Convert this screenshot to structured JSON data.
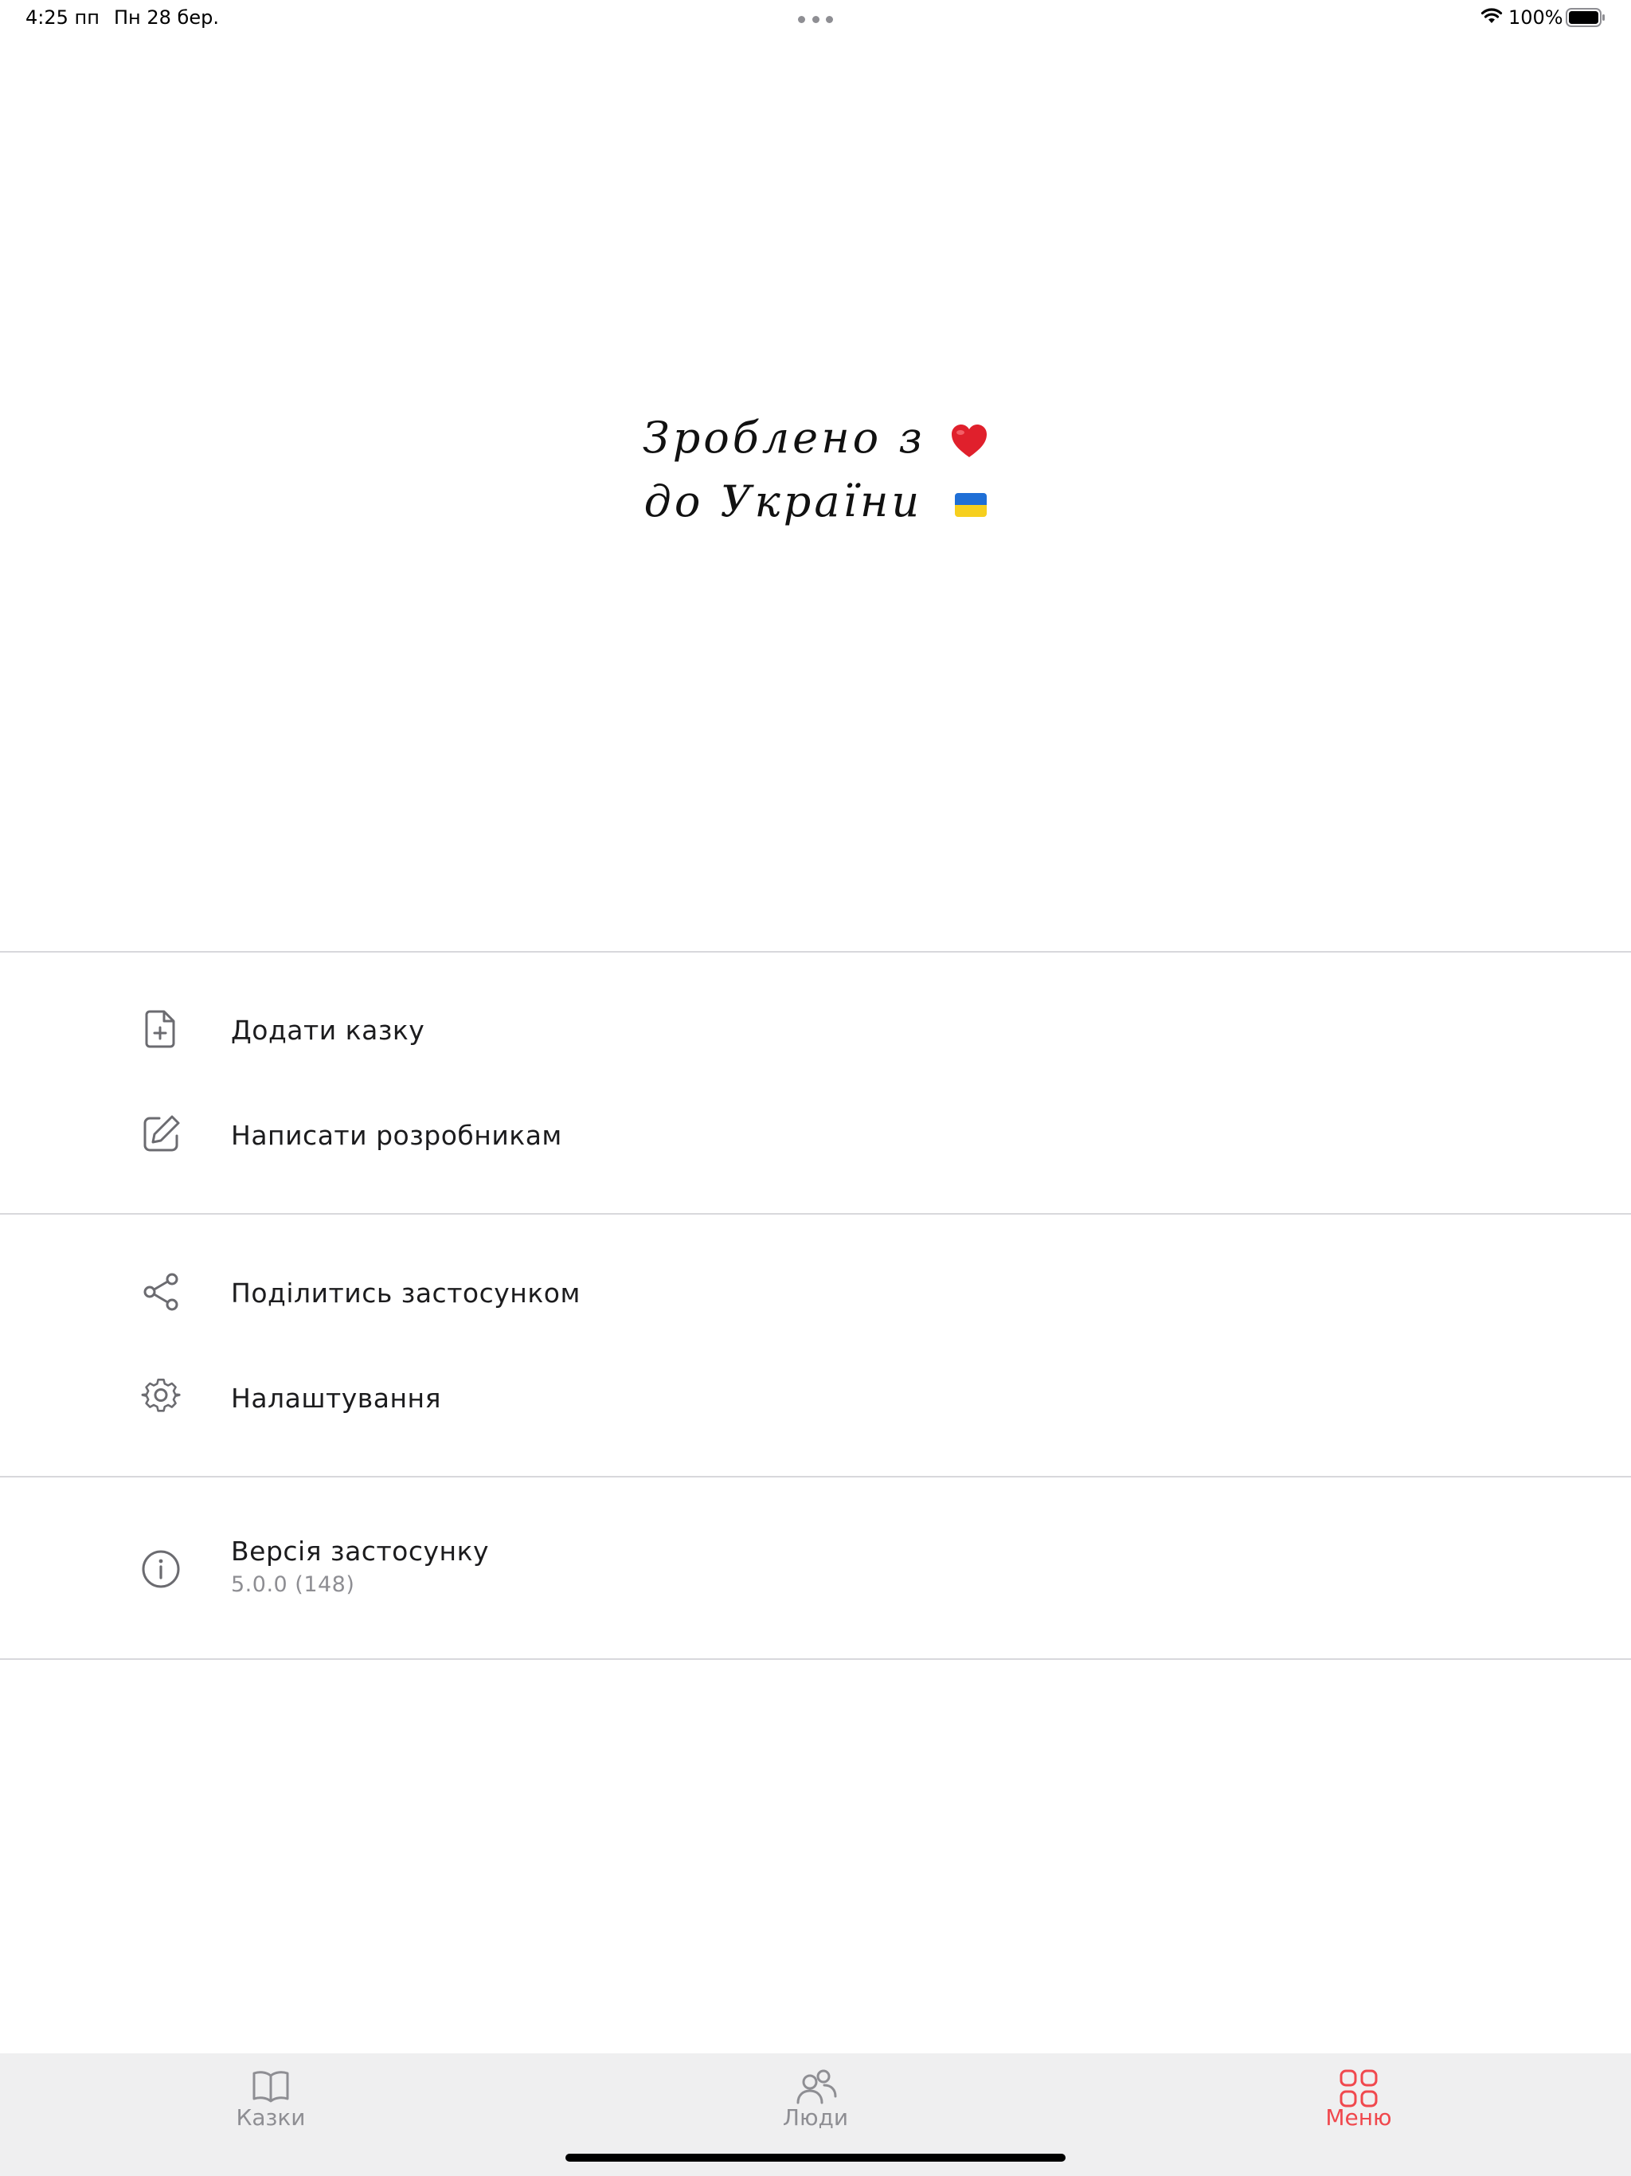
{
  "status_bar": {
    "time": "4:25 пп",
    "date": "Пн 28 бер.",
    "battery_percent": "100%",
    "icons": [
      "more-dots-icon",
      "wifi-icon",
      "battery-icon"
    ]
  },
  "hero": {
    "line1": "Зроблено з",
    "line2": "до України",
    "icons": [
      "heart-icon",
      "ukraine-flag-icon"
    ]
  },
  "menu": {
    "sections": [
      {
        "items": [
          {
            "label": "Додати казку",
            "icon": "add-document-icon"
          },
          {
            "label": "Написати розробникам",
            "icon": "edit-icon"
          }
        ]
      },
      {
        "items": [
          {
            "label": "Поділитись застосунком",
            "icon": "share-icon"
          },
          {
            "label": "Налаштування",
            "icon": "gear-icon"
          }
        ]
      },
      {
        "items": [
          {
            "label": "Версія застосунку",
            "sublabel": "5.0.0 (148)",
            "icon": "info-icon"
          }
        ]
      }
    ]
  },
  "tab_bar": {
    "tabs": [
      {
        "label": "Казки",
        "icon": "book-icon",
        "active": false
      },
      {
        "label": "Люди",
        "icon": "people-icon",
        "active": false
      },
      {
        "label": "Меню",
        "icon": "grid-icon",
        "active": true
      }
    ]
  },
  "colors": {
    "accent": "#f0484d",
    "text_primary": "#1c1c1e",
    "text_secondary": "#8e8e93",
    "divider": "#d8d8dc",
    "tab_bar_bg": "#efeff0",
    "flag_blue": "#1f6fd6",
    "flag_yellow": "#f6cf1e",
    "heart": "#e0202c"
  }
}
